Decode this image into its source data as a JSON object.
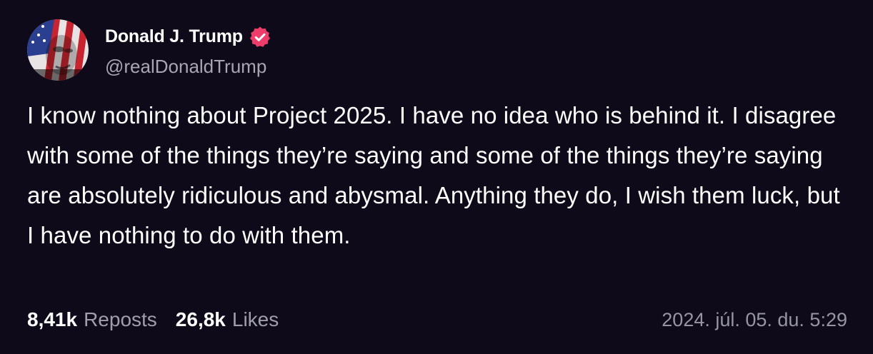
{
  "author": {
    "display_name": "Donald J. Trump",
    "handle": "@realDonaldTrump",
    "avatar_icon": "avatar-flag-portrait",
    "verified_icon": "verified-badge-icon"
  },
  "post": {
    "text": "I know nothing about Project 2025. I have no idea who is behind it. I disagree with some of the things they’re saying and some of the things they’re saying are absolutely ridiculous and abysmal. Anything they do, I wish them luck, but I have nothing to do with them."
  },
  "stats": {
    "reposts_count": "8,41k",
    "reposts_label": "Reposts",
    "likes_count": "26,8k",
    "likes_label": "Likes"
  },
  "timestamp": "2024. júl. 05. du. 5:29",
  "colors": {
    "background": "#0e0a19",
    "verified": "#ef3d6b",
    "muted_text": "#a09ead"
  }
}
